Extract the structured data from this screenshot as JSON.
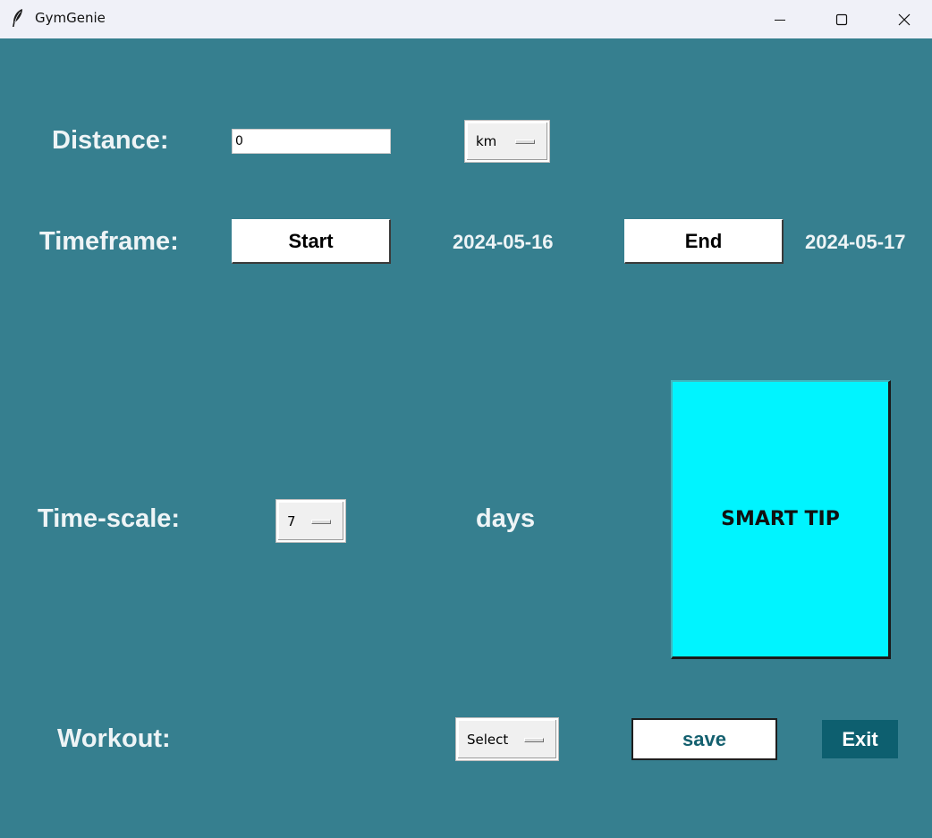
{
  "window": {
    "title": "GymGenie",
    "controls": {
      "minimize_icon": "minimize-icon",
      "maximize_icon": "maximize-icon",
      "close_icon": "close-icon"
    }
  },
  "distance": {
    "label": "Distance:",
    "value": "0",
    "unit_selected": "km"
  },
  "timeframe": {
    "label": "Timeframe:",
    "start_label": "Start",
    "start_date": "2024-05-16",
    "end_label": "End",
    "end_date": "2024-05-17"
  },
  "timescale": {
    "label": "Time-scale:",
    "selected": "7",
    "unit": "days"
  },
  "smart_tip": {
    "label": "SMART TIP"
  },
  "workout": {
    "label": "Workout:",
    "selected": "Select"
  },
  "actions": {
    "save_label": "save",
    "exit_label": "Exit"
  },
  "colors": {
    "background": "#367f8f",
    "titlebar": "#f0f1f8",
    "smart_tip": "#00f4ff",
    "exit_button": "#0d5f6f",
    "save_text": "#14606f"
  }
}
